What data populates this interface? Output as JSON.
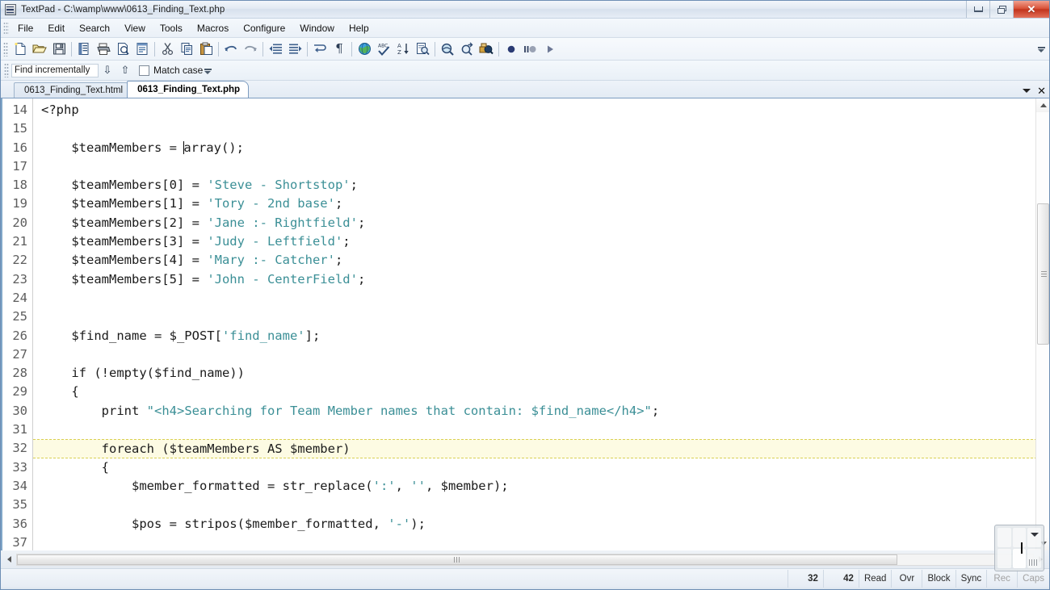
{
  "window": {
    "title": "TextPad - C:\\wamp\\www\\0613_Finding_Text.php",
    "app_icon": "textpad-icon",
    "controls": {
      "minimize": "minimize-icon",
      "restore": "restore-icon",
      "close": "✕"
    }
  },
  "menubar": {
    "items": [
      {
        "label": "File"
      },
      {
        "label": "Edit"
      },
      {
        "label": "Search"
      },
      {
        "label": "View"
      },
      {
        "label": "Tools"
      },
      {
        "label": "Macros"
      },
      {
        "label": "Configure"
      },
      {
        "label": "Window"
      },
      {
        "label": "Help"
      }
    ]
  },
  "toolbar": {
    "buttons": [
      {
        "name": "new-file-icon"
      },
      {
        "name": "open-file-icon"
      },
      {
        "name": "save-file-icon"
      },
      {
        "sep": true
      },
      {
        "name": "file-properties-icon"
      },
      {
        "name": "print-icon"
      },
      {
        "name": "print-preview-icon"
      },
      {
        "name": "document-view-icon"
      },
      {
        "sep": true
      },
      {
        "name": "cut-icon"
      },
      {
        "name": "copy-icon"
      },
      {
        "name": "paste-icon"
      },
      {
        "sep": true
      },
      {
        "name": "undo-icon"
      },
      {
        "name": "redo-icon"
      },
      {
        "sep": true
      },
      {
        "name": "decrease-indent-icon"
      },
      {
        "name": "increase-indent-icon"
      },
      {
        "sep": true
      },
      {
        "name": "word-wrap-icon"
      },
      {
        "name": "show-paragraph-marks-icon"
      },
      {
        "sep": true
      },
      {
        "name": "web-browser-icon"
      },
      {
        "name": "spell-check-icon"
      },
      {
        "name": "sort-icon"
      },
      {
        "name": "find-in-files-icon"
      },
      {
        "sep": true
      },
      {
        "name": "find-icon"
      },
      {
        "name": "find-next-icon"
      },
      {
        "name": "replace-icon"
      },
      {
        "sep": true
      },
      {
        "name": "record-macro-icon"
      },
      {
        "name": "pause-macro-icon"
      },
      {
        "name": "play-macro-icon"
      }
    ],
    "overflow": "toolbar-overflow-icon"
  },
  "findbar": {
    "input_value": "Find incrementally",
    "input_placeholder": "Find incrementally",
    "find_previous": "⇩",
    "find_next": "⇧",
    "match_case_label": "Match case",
    "match_case_checked": false,
    "overflow": "findbar-overflow-icon"
  },
  "tabs": {
    "items": [
      {
        "label": "0613_Finding_Text.html",
        "active": false
      },
      {
        "label": "0613_Finding_Text.php",
        "active": true
      }
    ],
    "dropdown": "tab-list-dropdown-icon",
    "close": "✕"
  },
  "editor": {
    "first_line": 14,
    "bookmarked_line": 32,
    "caret_line": 16,
    "lines": [
      {
        "n": 14,
        "segments": [
          {
            "t": "<?php"
          }
        ]
      },
      {
        "n": 15,
        "segments": [
          {
            "t": ""
          }
        ]
      },
      {
        "n": 16,
        "segments": [
          {
            "t": "    $teamMembers = array();"
          }
        ]
      },
      {
        "n": 17,
        "segments": [
          {
            "t": ""
          }
        ]
      },
      {
        "n": 18,
        "segments": [
          {
            "t": "    $teamMembers[0] = "
          },
          {
            "t": "'Steve - Shortstop'",
            "c": "str"
          },
          {
            "t": ";"
          }
        ]
      },
      {
        "n": 19,
        "segments": [
          {
            "t": "    $teamMembers[1] = "
          },
          {
            "t": "'Tory - 2nd base'",
            "c": "str"
          },
          {
            "t": ";"
          }
        ]
      },
      {
        "n": 20,
        "segments": [
          {
            "t": "    $teamMembers[2] = "
          },
          {
            "t": "'Jane :- Rightfield'",
            "c": "str"
          },
          {
            "t": ";"
          }
        ]
      },
      {
        "n": 21,
        "segments": [
          {
            "t": "    $teamMembers[3] = "
          },
          {
            "t": "'Judy - Leftfield'",
            "c": "str"
          },
          {
            "t": ";"
          }
        ]
      },
      {
        "n": 22,
        "segments": [
          {
            "t": "    $teamMembers[4] = "
          },
          {
            "t": "'Mary :- Catcher'",
            "c": "str"
          },
          {
            "t": ";"
          }
        ]
      },
      {
        "n": 23,
        "segments": [
          {
            "t": "    $teamMembers[5] = "
          },
          {
            "t": "'John - CenterField'",
            "c": "str"
          },
          {
            "t": ";"
          }
        ]
      },
      {
        "n": 24,
        "segments": [
          {
            "t": ""
          }
        ]
      },
      {
        "n": 25,
        "segments": [
          {
            "t": ""
          }
        ]
      },
      {
        "n": 26,
        "segments": [
          {
            "t": "    $find_name = $_POST["
          },
          {
            "t": "'find_name'",
            "c": "str"
          },
          {
            "t": "];"
          }
        ]
      },
      {
        "n": 27,
        "segments": [
          {
            "t": ""
          }
        ]
      },
      {
        "n": 28,
        "segments": [
          {
            "t": "    if (!empty($find_name))"
          }
        ]
      },
      {
        "n": 29,
        "segments": [
          {
            "t": "    {"
          }
        ]
      },
      {
        "n": 30,
        "segments": [
          {
            "t": "        print "
          },
          {
            "t": "\"<h4>Searching for Team Member names that contain: $find_name</h4>\"",
            "c": "str"
          },
          {
            "t": ";"
          }
        ]
      },
      {
        "n": 31,
        "segments": [
          {
            "t": ""
          }
        ]
      },
      {
        "n": 32,
        "segments": [
          {
            "t": "        foreach ($teamMembers AS $member)"
          }
        ],
        "bookmark": true
      },
      {
        "n": 33,
        "segments": [
          {
            "t": "        {"
          }
        ]
      },
      {
        "n": 34,
        "segments": [
          {
            "t": "            $member_formatted = str_replace("
          },
          {
            "t": "':'",
            "c": "str"
          },
          {
            "t": ", "
          },
          {
            "t": "''",
            "c": "str"
          },
          {
            "t": ", $member);"
          }
        ]
      },
      {
        "n": 35,
        "segments": [
          {
            "t": ""
          }
        ]
      },
      {
        "n": 36,
        "segments": [
          {
            "t": "            $pos = stripos($member_formatted, "
          },
          {
            "t": "'-'",
            "c": "str"
          },
          {
            "t": ");"
          }
        ]
      },
      {
        "n": 37,
        "segments": [
          {
            "t": ""
          }
        ]
      }
    ]
  },
  "scrollbars": {
    "v_up": "scroll-up-icon",
    "v_down": "scroll-down-icon",
    "h_left": "scroll-left-icon",
    "h_right": "scroll-right-icon"
  },
  "statusbar": {
    "line": "32",
    "column": "42",
    "cells": [
      {
        "label": "Read",
        "dim": false
      },
      {
        "label": "Ovr",
        "dim": false
      },
      {
        "label": "Block",
        "dim": false
      },
      {
        "label": "Sync",
        "dim": false
      },
      {
        "label": "Rec",
        "dim": true
      },
      {
        "label": "Caps",
        "dim": true
      }
    ]
  },
  "overlay_widget": {
    "name": "floating-onscreen-keypad",
    "dropdown_icon": "chevron-down-icon",
    "grip_icon": "resize-grip-icon"
  },
  "colors": {
    "string_literal": "#3b8f96",
    "bookmark_row": "#fdfbe3",
    "bookmark_border": "#d9cf52",
    "title_bar": "#e2eaf3",
    "close_button": "#c2341c",
    "gutter_text": "#5d5d5d",
    "code_text": "#1b1b1b"
  }
}
